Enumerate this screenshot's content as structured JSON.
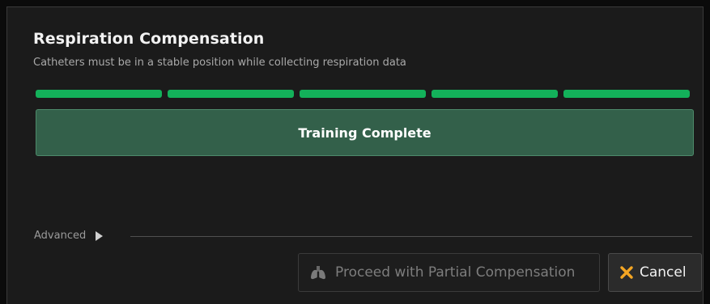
{
  "dialog": {
    "title": "Respiration Compensation",
    "subtitle": "Catheters must be in a stable position while collecting respiration data"
  },
  "progress": {
    "completed_steps": 5,
    "total_steps": 5,
    "color": "#13b15a"
  },
  "status": {
    "text": "Training Complete",
    "color": "#33604a"
  },
  "advanced": {
    "label": "Advanced",
    "icon": "triangle-right-icon",
    "expanded": false
  },
  "actions": {
    "proceed": {
      "label": "Proceed with Partial Compensation",
      "icon": "lungs-icon",
      "enabled": false
    },
    "cancel": {
      "label": "Cancel",
      "icon": "x-icon",
      "icon_color": "#f5a623"
    }
  }
}
